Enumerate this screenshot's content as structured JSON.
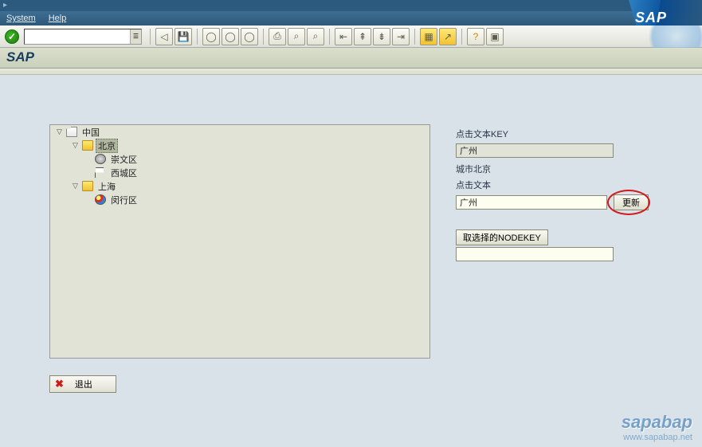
{
  "menubar": {
    "system": "System",
    "help": "Help"
  },
  "logo": "SAP",
  "app_title": "SAP",
  "tree": {
    "root": {
      "label": "中国"
    },
    "beijing": {
      "label": "北京"
    },
    "chongwen": {
      "label": "崇文区"
    },
    "xicheng": {
      "label": "西城区"
    },
    "shanghai": {
      "label": "上海"
    },
    "minhang": {
      "label": "闵行区"
    }
  },
  "exit_button": "退出",
  "form": {
    "label_key": "点击文本KEY",
    "value_key": "广州",
    "label_city": "城市北京",
    "label_text": "点击文本",
    "value_text": "广州",
    "update_btn": "更新",
    "nodekey_btn": "取选择的NODEKEY",
    "value_nodekey": ""
  },
  "watermark": {
    "big": "sapabap",
    "url": "www.sapabap.net"
  }
}
